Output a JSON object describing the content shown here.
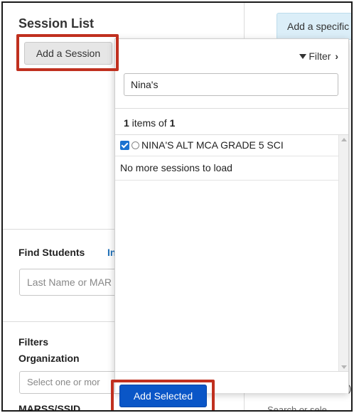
{
  "left": {
    "title": "Session List",
    "add_session_label": "Add a Session",
    "find_students_label": "Find Students",
    "find_students_link": "In",
    "search_placeholder": "Last Name or MAR",
    "filters_label": "Filters",
    "organization_label": "Organization",
    "organization_placeholder": "Select one or mor",
    "marss_label": "MARSS/SSID"
  },
  "right": {
    "banner_text": "Add a specific",
    "bottom_text": "Search or sele"
  },
  "panel": {
    "filter_label": "Filter",
    "search_value": "Nina's",
    "count_number": "1",
    "count_text": " items of ",
    "count_total": "1",
    "items": [
      {
        "label": "NINA'S ALT MCA GRADE 5 SCI",
        "checked": true
      }
    ],
    "no_more_text": "No more sessions to load",
    "add_selected_label": "Add Selected"
  },
  "colors": {
    "highlight": "#c0301f",
    "primary_button": "#0a56c7",
    "banner": "#dbeef8"
  }
}
